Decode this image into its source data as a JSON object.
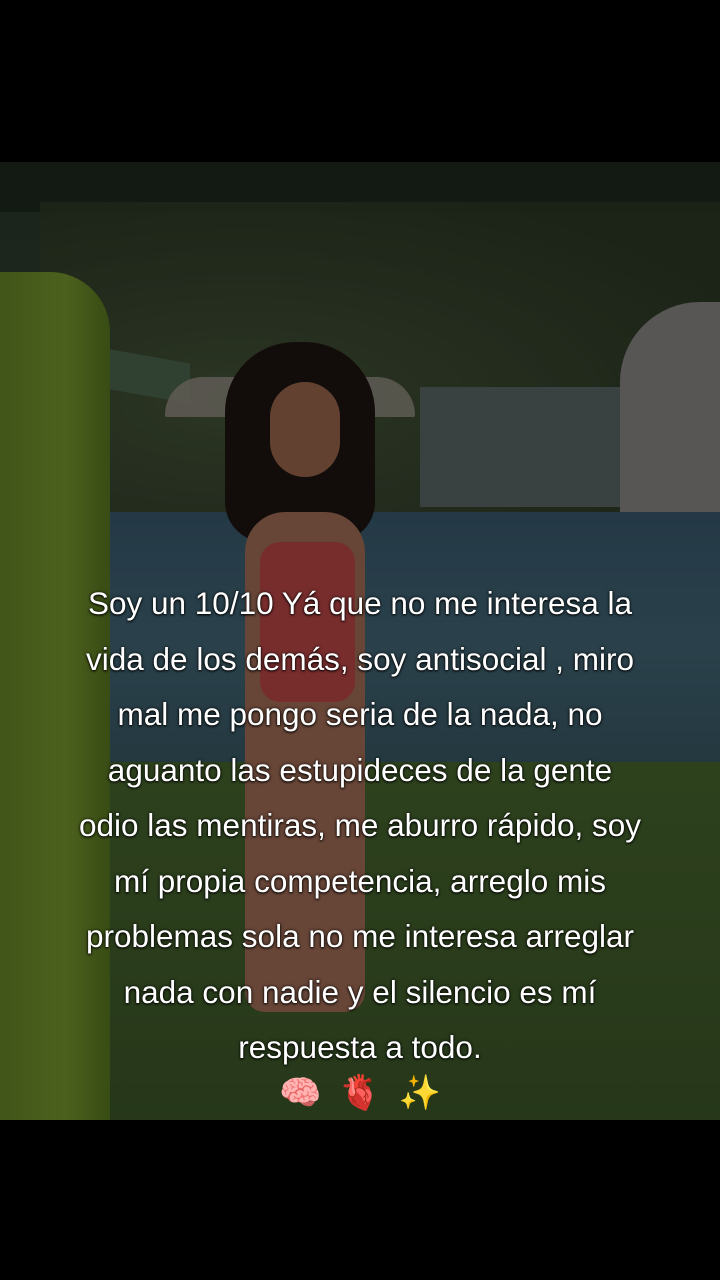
{
  "video": {
    "scene_description_icon": "video-background-icon"
  },
  "caption": {
    "lines": [
      "Soy un 10/10 Yá que no me interesa la",
      "vida de los demás, soy antisocial , miro",
      "mal me pongo seria de la nada, no",
      "aguanto las estupideces de la gente",
      "odio las mentiras, me aburro rápido, soy",
      "mí propia competencia, arreglo mis",
      "problemas sola no me interesa arreglar",
      "nada con nadie y el silencio es mí",
      "respuesta a todo."
    ],
    "emojis": [
      "🧠",
      "🫀",
      "✨"
    ]
  },
  "colors": {
    "background": "#000000",
    "caption_text": "#ffffff"
  }
}
